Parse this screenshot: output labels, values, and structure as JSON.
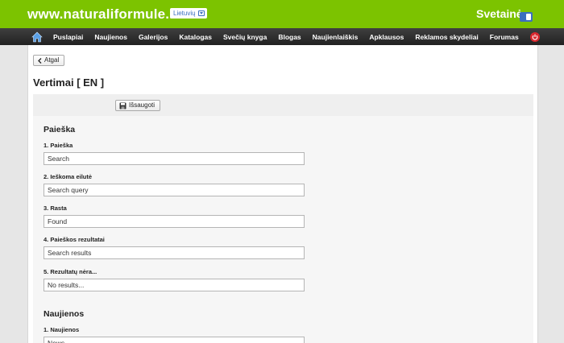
{
  "header": {
    "site_title": "www.naturaliformule.lt",
    "language": "Lietuvių",
    "brand": "Svetainė"
  },
  "nav": {
    "items": [
      "Puslapiai",
      "Naujienos",
      "Galerijos",
      "Katalogas",
      "Svečių knyga",
      "Blogas",
      "Naujienlaiškis",
      "Apklausos",
      "Reklamos skydeliai",
      "Forumas"
    ]
  },
  "page": {
    "back_label": "Atgal",
    "title": "Vertimai [ EN ]",
    "save_label": "Išsaugoti"
  },
  "sections": {
    "search": {
      "title": "Paieška",
      "fields": [
        {
          "label": "1. Paieška",
          "value": "Search"
        },
        {
          "label": "2. Ieškoma eilutė",
          "value": "Search query"
        },
        {
          "label": "3. Rasta",
          "value": "Found"
        },
        {
          "label": "4. Paieškos rezultatai",
          "value": "Search results"
        },
        {
          "label": "5. Rezultatų nėra...",
          "value": "No results..."
        }
      ]
    },
    "news": {
      "title": "Naujienos",
      "fields": [
        {
          "label": "1. Naujienos",
          "value": "News"
        }
      ]
    }
  },
  "colors": {
    "topbar": "#7cc300",
    "navbar": "#2b2b2b",
    "power": "#d9272e"
  }
}
